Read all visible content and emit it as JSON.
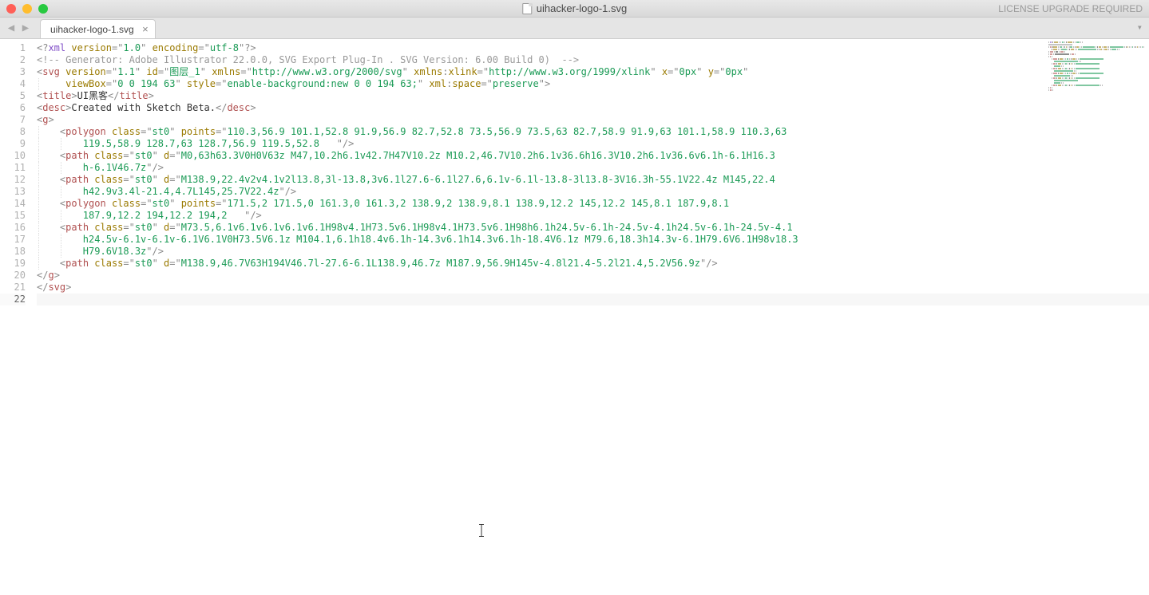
{
  "window": {
    "title": "uihacker-logo-1.svg",
    "license_text": "LICENSE UPGRADE REQUIRED"
  },
  "tab": {
    "label": "uihacker-logo-1.svg"
  },
  "gutter": {
    "lines": [
      "1",
      "2",
      "3",
      "4",
      "5",
      "6",
      "7",
      "8",
      "9",
      "10",
      "11",
      "12",
      "13",
      "14",
      "15",
      "16",
      "17",
      "18",
      "19",
      "20",
      "21",
      "22"
    ],
    "current": 22
  },
  "code": {
    "lines": [
      {
        "indent": 0,
        "tokens": [
          [
            "punc",
            "<?"
          ],
          [
            "decl",
            "xml"
          ],
          [
            "text",
            " "
          ],
          [
            "attr",
            "version"
          ],
          [
            "punc",
            "="
          ],
          [
            "q",
            "\""
          ],
          [
            "str",
            "1.0"
          ],
          [
            "q",
            "\""
          ],
          [
            "text",
            " "
          ],
          [
            "attr",
            "encoding"
          ],
          [
            "punc",
            "="
          ],
          [
            "q",
            "\""
          ],
          [
            "str",
            "utf-8"
          ],
          [
            "q",
            "\""
          ],
          [
            "punc",
            "?>"
          ]
        ]
      },
      {
        "indent": 0,
        "tokens": [
          [
            "comment",
            "<!-- Generator: Adobe Illustrator 22.0.0, SVG Export Plug-In . SVG Version: 6.00 Build 0)  -->"
          ]
        ]
      },
      {
        "indent": 0,
        "tokens": [
          [
            "punc",
            "<"
          ],
          [
            "tag",
            "svg"
          ],
          [
            "text",
            " "
          ],
          [
            "attr",
            "version"
          ],
          [
            "punc",
            "="
          ],
          [
            "q",
            "\""
          ],
          [
            "str",
            "1.1"
          ],
          [
            "q",
            "\""
          ],
          [
            "text",
            " "
          ],
          [
            "attr",
            "id"
          ],
          [
            "punc",
            "="
          ],
          [
            "q",
            "\""
          ],
          [
            "str",
            "图层_1"
          ],
          [
            "q",
            "\""
          ],
          [
            "text",
            " "
          ],
          [
            "attr",
            "xmlns"
          ],
          [
            "punc",
            "="
          ],
          [
            "q",
            "\""
          ],
          [
            "str",
            "http://www.w3.org/2000/svg"
          ],
          [
            "q",
            "\""
          ],
          [
            "text",
            " "
          ],
          [
            "attr",
            "xmlns"
          ],
          [
            "punc",
            ":"
          ],
          [
            "attr",
            "xlink"
          ],
          [
            "punc",
            "="
          ],
          [
            "q",
            "\""
          ],
          [
            "str",
            "http://www.w3.org/1999/xlink"
          ],
          [
            "q",
            "\""
          ],
          [
            "text",
            " "
          ],
          [
            "attr",
            "x"
          ],
          [
            "punc",
            "="
          ],
          [
            "q",
            "\""
          ],
          [
            "str",
            "0px"
          ],
          [
            "q",
            "\""
          ],
          [
            "text",
            " "
          ],
          [
            "attr",
            "y"
          ],
          [
            "punc",
            "="
          ],
          [
            "q",
            "\""
          ],
          [
            "str",
            "0px"
          ],
          [
            "q",
            "\""
          ]
        ]
      },
      {
        "indent": 1,
        "tokens": [
          [
            "text",
            " "
          ],
          [
            "attr",
            "viewBox"
          ],
          [
            "punc",
            "="
          ],
          [
            "q",
            "\""
          ],
          [
            "str",
            "0 0 194 63"
          ],
          [
            "q",
            "\""
          ],
          [
            "text",
            " "
          ],
          [
            "attr",
            "style"
          ],
          [
            "punc",
            "="
          ],
          [
            "q",
            "\""
          ],
          [
            "str",
            "enable-background:new 0 0 194 63;"
          ],
          [
            "q",
            "\""
          ],
          [
            "text",
            " "
          ],
          [
            "attr",
            "xml"
          ],
          [
            "punc",
            ":"
          ],
          [
            "attr",
            "space"
          ],
          [
            "punc",
            "="
          ],
          [
            "q",
            "\""
          ],
          [
            "str",
            "preserve"
          ],
          [
            "q",
            "\""
          ],
          [
            "punc",
            ">"
          ]
        ]
      },
      {
        "indent": 0,
        "tokens": [
          [
            "punc",
            "<"
          ],
          [
            "tag",
            "title"
          ],
          [
            "punc",
            ">"
          ],
          [
            "text",
            "UI黑客"
          ],
          [
            "punc",
            "</"
          ],
          [
            "tag",
            "title"
          ],
          [
            "punc",
            ">"
          ]
        ]
      },
      {
        "indent": 0,
        "tokens": [
          [
            "punc",
            "<"
          ],
          [
            "tag",
            "desc"
          ],
          [
            "punc",
            ">"
          ],
          [
            "text",
            "Created with Sketch Beta."
          ],
          [
            "punc",
            "</"
          ],
          [
            "tag",
            "desc"
          ],
          [
            "punc",
            ">"
          ]
        ]
      },
      {
        "indent": 0,
        "tokens": [
          [
            "punc",
            "<"
          ],
          [
            "tag",
            "g"
          ],
          [
            "punc",
            ">"
          ]
        ]
      },
      {
        "indent": 1,
        "tokens": [
          [
            "punc",
            "<"
          ],
          [
            "tag",
            "polygon"
          ],
          [
            "text",
            " "
          ],
          [
            "attr",
            "class"
          ],
          [
            "punc",
            "="
          ],
          [
            "q",
            "\""
          ],
          [
            "str",
            "st0"
          ],
          [
            "q",
            "\""
          ],
          [
            "text",
            " "
          ],
          [
            "attr",
            "points"
          ],
          [
            "punc",
            "="
          ],
          [
            "q",
            "\""
          ],
          [
            "str",
            "110.3,56.9 101.1,52.8 91.9,56.9 82.7,52.8 73.5,56.9 73.5,63 82.7,58.9 91.9,63 101.1,58.9 110.3,63 "
          ]
        ]
      },
      {
        "indent": 2,
        "tokens": [
          [
            "str",
            "119.5,58.9 128.7,63 128.7,56.9 119.5,52.8   "
          ],
          [
            "q",
            "\""
          ],
          [
            "punc",
            "/>"
          ]
        ]
      },
      {
        "indent": 1,
        "tokens": [
          [
            "punc",
            "<"
          ],
          [
            "tag",
            "path"
          ],
          [
            "text",
            " "
          ],
          [
            "attr",
            "class"
          ],
          [
            "punc",
            "="
          ],
          [
            "q",
            "\""
          ],
          [
            "str",
            "st0"
          ],
          [
            "q",
            "\""
          ],
          [
            "text",
            " "
          ],
          [
            "attr",
            "d"
          ],
          [
            "punc",
            "="
          ],
          [
            "q",
            "\""
          ],
          [
            "str",
            "M0,63h63.3V0H0V63z M47,10.2h6.1v42.7H47V10.2z M10.2,46.7V10.2h6.1v36.6h16.3V10.2h6.1v36.6v6.1h-6.1H16.3"
          ]
        ]
      },
      {
        "indent": 2,
        "tokens": [
          [
            "str",
            "h-6.1V46.7z"
          ],
          [
            "q",
            "\""
          ],
          [
            "punc",
            "/>"
          ]
        ]
      },
      {
        "indent": 1,
        "tokens": [
          [
            "punc",
            "<"
          ],
          [
            "tag",
            "path"
          ],
          [
            "text",
            " "
          ],
          [
            "attr",
            "class"
          ],
          [
            "punc",
            "="
          ],
          [
            "q",
            "\""
          ],
          [
            "str",
            "st0"
          ],
          [
            "q",
            "\""
          ],
          [
            "text",
            " "
          ],
          [
            "attr",
            "d"
          ],
          [
            "punc",
            "="
          ],
          [
            "q",
            "\""
          ],
          [
            "str",
            "M138.9,22.4v2v4.1v2l13.8,3l-13.8,3v6.1l27.6-6.1l27.6,6.1v-6.1l-13.8-3l13.8-3V16.3h-55.1V22.4z M145,22.4"
          ]
        ]
      },
      {
        "indent": 2,
        "tokens": [
          [
            "str",
            "h42.9v3.4l-21.4,4.7L145,25.7V22.4z"
          ],
          [
            "q",
            "\""
          ],
          [
            "punc",
            "/>"
          ]
        ]
      },
      {
        "indent": 1,
        "tokens": [
          [
            "punc",
            "<"
          ],
          [
            "tag",
            "polygon"
          ],
          [
            "text",
            " "
          ],
          [
            "attr",
            "class"
          ],
          [
            "punc",
            "="
          ],
          [
            "q",
            "\""
          ],
          [
            "str",
            "st0"
          ],
          [
            "q",
            "\""
          ],
          [
            "text",
            " "
          ],
          [
            "attr",
            "points"
          ],
          [
            "punc",
            "="
          ],
          [
            "q",
            "\""
          ],
          [
            "str",
            "171.5,2 171.5,0 161.3,0 161.3,2 138.9,2 138.9,8.1 138.9,12.2 145,12.2 145,8.1 187.9,8.1 "
          ]
        ]
      },
      {
        "indent": 2,
        "tokens": [
          [
            "str",
            "187.9,12.2 194,12.2 194,2   "
          ],
          [
            "q",
            "\""
          ],
          [
            "punc",
            "/>"
          ]
        ]
      },
      {
        "indent": 1,
        "tokens": [
          [
            "punc",
            "<"
          ],
          [
            "tag",
            "path"
          ],
          [
            "text",
            " "
          ],
          [
            "attr",
            "class"
          ],
          [
            "punc",
            "="
          ],
          [
            "q",
            "\""
          ],
          [
            "str",
            "st0"
          ],
          [
            "q",
            "\""
          ],
          [
            "text",
            " "
          ],
          [
            "attr",
            "d"
          ],
          [
            "punc",
            "="
          ],
          [
            "q",
            "\""
          ],
          [
            "str",
            "M73.5,6.1v6.1v6.1v6.1v6.1H98v4.1H73.5v6.1H98v4.1H73.5v6.1H98h6.1h24.5v-6.1h-24.5v-4.1h24.5v-6.1h-24.5v-4.1"
          ]
        ]
      },
      {
        "indent": 2,
        "tokens": [
          [
            "str",
            "h24.5v-6.1v-6.1v-6.1V6.1V0H73.5V6.1z M104.1,6.1h18.4v6.1h-14.3v6.1h14.3v6.1h-18.4V6.1z M79.6,18.3h14.3v-6.1H79.6V6.1H98v18.3"
          ]
        ]
      },
      {
        "indent": 2,
        "tokens": [
          [
            "str",
            "H79.6V18.3z"
          ],
          [
            "q",
            "\""
          ],
          [
            "punc",
            "/>"
          ]
        ]
      },
      {
        "indent": 1,
        "tokens": [
          [
            "punc",
            "<"
          ],
          [
            "tag",
            "path"
          ],
          [
            "text",
            " "
          ],
          [
            "attr",
            "class"
          ],
          [
            "punc",
            "="
          ],
          [
            "q",
            "\""
          ],
          [
            "str",
            "st0"
          ],
          [
            "q",
            "\""
          ],
          [
            "text",
            " "
          ],
          [
            "attr",
            "d"
          ],
          [
            "punc",
            "="
          ],
          [
            "q",
            "\""
          ],
          [
            "str",
            "M138.9,46.7V63H194V46.7l-27.6-6.1L138.9,46.7z M187.9,56.9H145v-4.8l21.4-5.2l21.4,5.2V56.9z"
          ],
          [
            "q",
            "\""
          ],
          [
            "punc",
            "/>"
          ]
        ]
      },
      {
        "indent": 0,
        "tokens": [
          [
            "punc",
            "</"
          ],
          [
            "tag",
            "g"
          ],
          [
            "punc",
            ">"
          ]
        ]
      },
      {
        "indent": 0,
        "tokens": [
          [
            "punc",
            "</"
          ],
          [
            "tag",
            "svg"
          ],
          [
            "punc",
            ">"
          ]
        ]
      },
      {
        "indent": 0,
        "tokens": []
      }
    ]
  },
  "colors": {
    "decl": "#8250c8",
    "tag": "#b05050",
    "attr": "#9a7a00",
    "punc": "#8a8a8a",
    "str": "#1a9a55",
    "comment": "#999999",
    "text": "#333333"
  }
}
